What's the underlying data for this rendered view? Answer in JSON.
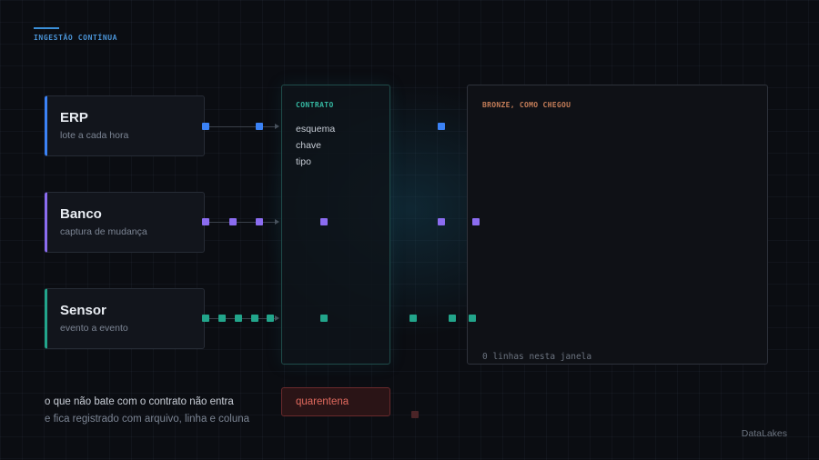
{
  "header": {
    "label": "INGESTÃO CONTÍNUA"
  },
  "sources": [
    {
      "name": "ERP",
      "subtitle": "lote a cada hora",
      "color": "#3b82f6"
    },
    {
      "name": "Banco",
      "subtitle": "captura de mudança",
      "color": "#8b6cf0"
    },
    {
      "name": "Sensor",
      "subtitle": "evento a evento",
      "color": "#22a58b"
    }
  ],
  "contract": {
    "title": "CONTRATO",
    "fields": [
      "esquema",
      "chave",
      "tipo"
    ]
  },
  "bronze": {
    "title": "BRONZE, COMO CHEGOU",
    "count_label": "0 linhas nesta janela"
  },
  "quarantine": {
    "label": "quarentena"
  },
  "footer": {
    "note_line1": "o que não bate com o contrato não entra",
    "note_line2": "e fica registrado com arquivo, linha e coluna",
    "brand": "DataLakes"
  }
}
